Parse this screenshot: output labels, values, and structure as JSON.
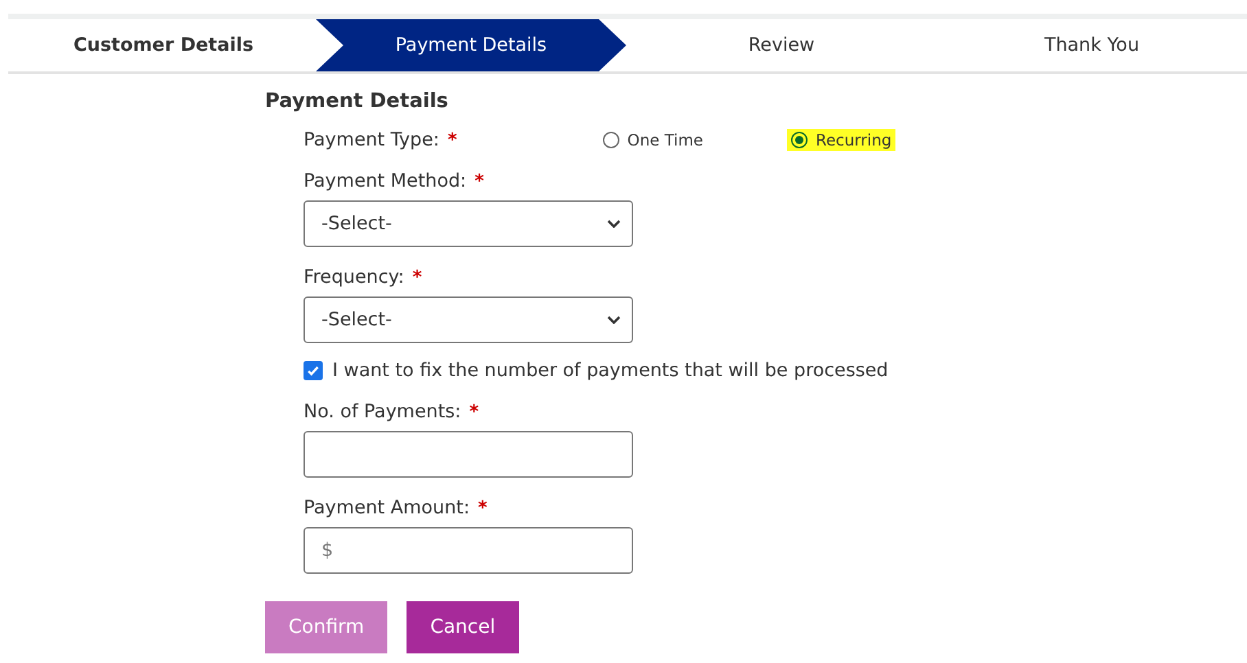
{
  "steps": [
    {
      "label": "Customer Details",
      "selected": false,
      "completed": true
    },
    {
      "label": "Payment Details",
      "selected": true,
      "completed": false
    },
    {
      "label": "Review",
      "selected": false,
      "completed": false
    },
    {
      "label": "Thank You",
      "selected": false,
      "completed": false
    }
  ],
  "section_title": "Payment Details",
  "payment_type": {
    "label": "Payment Type:",
    "required_mark": "*",
    "options": [
      {
        "label": "One Time",
        "selected": false,
        "highlighted": false
      },
      {
        "label": "Recurring",
        "selected": true,
        "highlighted": true
      }
    ]
  },
  "fields": [
    {
      "kind": "select",
      "label": "Payment Method:",
      "required_mark": "*",
      "value": "-Select-"
    },
    {
      "kind": "select",
      "label": "Frequency:",
      "required_mark": "*",
      "value": "-Select-"
    },
    {
      "kind": "checkbox",
      "label": "I want to fix the number of payments that will be processed",
      "checked": true
    },
    {
      "kind": "input",
      "label": "No. of Payments:",
      "required_mark": "*"
    },
    {
      "kind": "input",
      "label": "Payment Amount:",
      "required_mark": "*",
      "placeholder": "$"
    }
  ],
  "buttons": [
    {
      "label": "Confirm",
      "disabled": true
    },
    {
      "label": "Cancel",
      "disabled": false
    }
  ]
}
